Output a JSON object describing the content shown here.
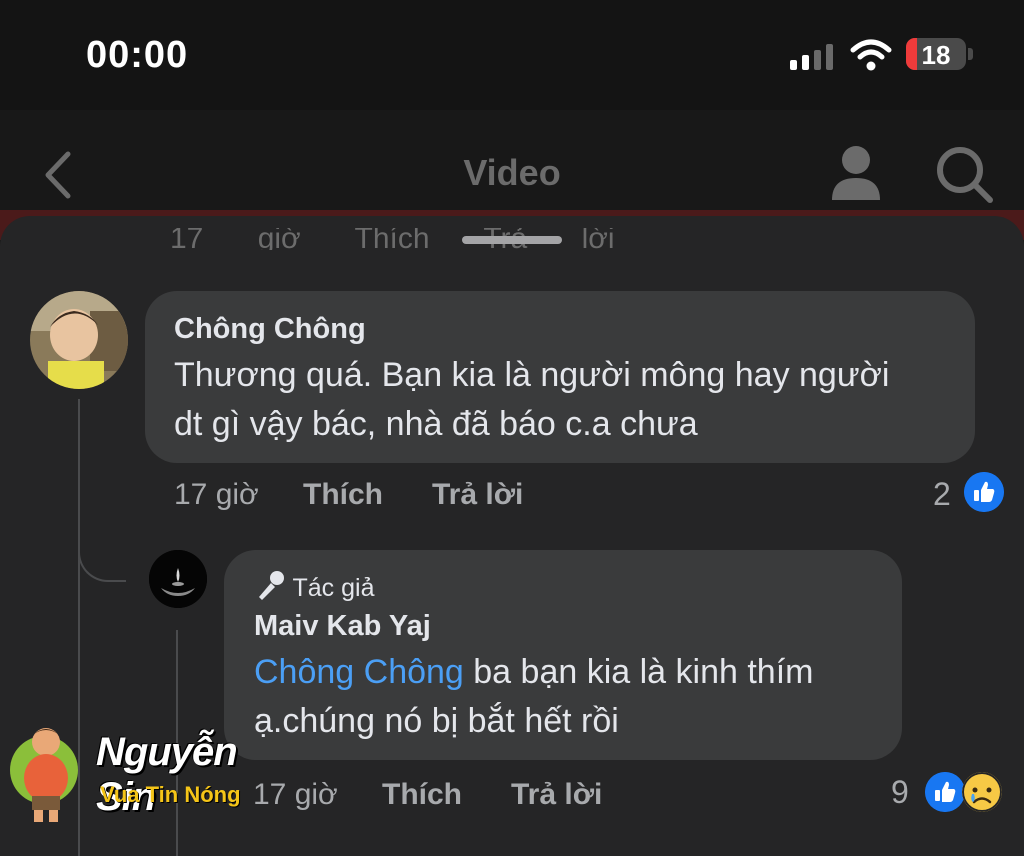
{
  "status_bar": {
    "time": "00:00",
    "battery_level": "18",
    "battery_fraction": 0.18
  },
  "nav": {
    "title": "Video"
  },
  "ghost_row": "17 giờ Thích Trả lời",
  "comments": [
    {
      "author": "Chông Chông",
      "text_line1": "Thương quá. Bạn kia là người mông hay người",
      "text_line2": "dt gì vậy bác, nhà đã báo c.a chưa",
      "time": "17 giờ",
      "like_label": "Thích",
      "reply_label": "Trả lời",
      "reaction_count": "2",
      "reactions": [
        "like-icon"
      ]
    },
    {
      "badge": "Tác giả",
      "author": "Maiv Kab Yaj",
      "mention": "Chông Chông",
      "text_line1": " ba bạn kia là kinh thím",
      "text_line2": "ạ.chúng nó bị bắt hết rồi",
      "time": "17 giờ",
      "like_label": "Thích",
      "reply_label": "Trả lời",
      "reaction_count": "9",
      "reactions": [
        "like-icon",
        "sad-icon"
      ]
    }
  ],
  "watermark": {
    "name": "Nguyễn Sin",
    "tagline": "Vua Tin Nóng"
  },
  "colors": {
    "accent": "#1877f2",
    "mention": "#4b9ff5",
    "bubble": "#3a3b3c",
    "sheet": "#252526"
  }
}
